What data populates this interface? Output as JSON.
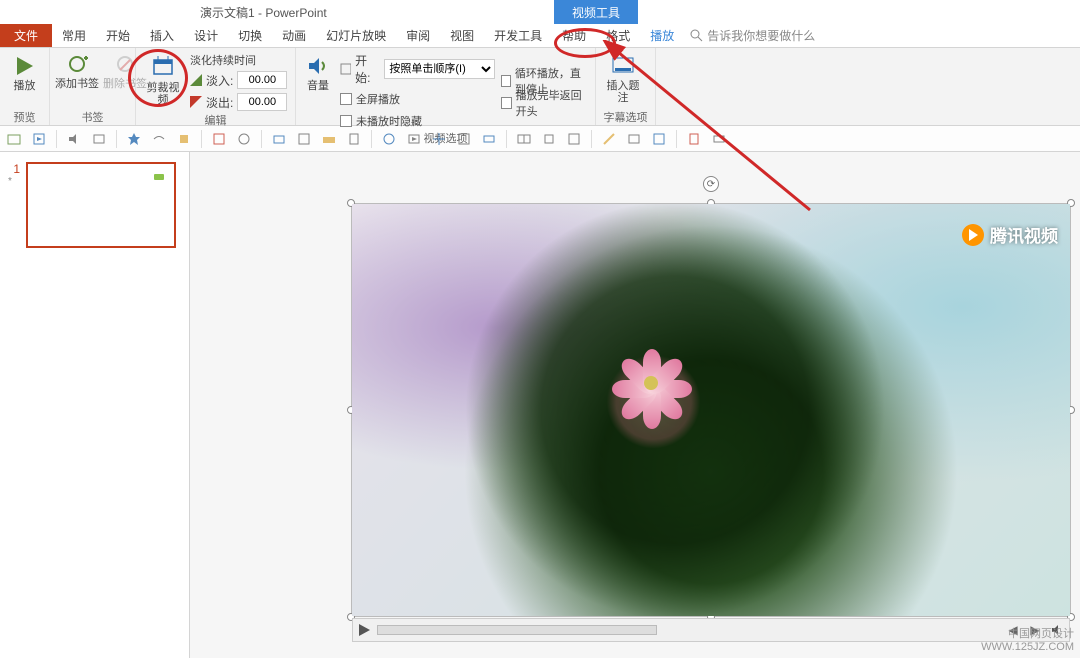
{
  "title": "演示文稿1 - PowerPoint",
  "contextual_tab": "视频工具",
  "tabs": {
    "file": "文件",
    "items": [
      "常用",
      "开始",
      "插入",
      "设计",
      "切换",
      "动画",
      "幻灯片放映",
      "审阅",
      "视图",
      "开发工具",
      "帮助",
      "格式",
      "播放"
    ],
    "tell_me": "告诉我你想要做什么"
  },
  "ribbon": {
    "preview": {
      "play": "播放",
      "label": "预览"
    },
    "bookmarks": {
      "add": "添加书签",
      "remove": "删除书签",
      "label": "书签"
    },
    "edit": {
      "trim": "剪裁视频",
      "fade_label": "淡化持续时间",
      "fade_in": "淡入:",
      "fade_out": "淡出:",
      "fade_in_val": "00.00",
      "fade_out_val": "00.00",
      "label": "编辑"
    },
    "volume": {
      "btn": "音量"
    },
    "options": {
      "start_lbl": "开始:",
      "start_val": "按照单击顺序(I)",
      "full": "全屏播放",
      "hide": "未播放时隐藏",
      "loop": "循环播放，直到停止",
      "rewind": "播放完毕返回开头",
      "label": "视频选项"
    },
    "caption": {
      "insert": "插入题注",
      "label": "字幕选项"
    }
  },
  "thumb": {
    "num": "1",
    "star": "*"
  },
  "brand": "腾讯视频",
  "watermark": {
    "l1": "中国网页设计",
    "l2": "WWW.125JZ.COM"
  }
}
